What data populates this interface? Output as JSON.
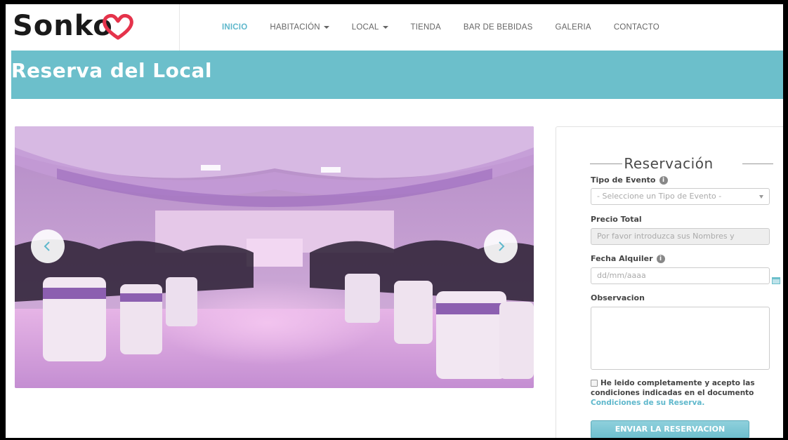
{
  "brand": {
    "logo_text": "Sonko"
  },
  "nav": {
    "items": [
      {
        "label": "INICIO",
        "active": true,
        "dropdown": false
      },
      {
        "label": "HABITACIÓN",
        "active": false,
        "dropdown": true
      },
      {
        "label": "LOCAL",
        "active": false,
        "dropdown": true
      },
      {
        "label": "TIENDA",
        "active": false,
        "dropdown": false
      },
      {
        "label": "BAR DE BEBIDAS",
        "active": false,
        "dropdown": false
      },
      {
        "label": "GALERIA",
        "active": false,
        "dropdown": false
      },
      {
        "label": "CONTACTO",
        "active": false,
        "dropdown": false
      }
    ]
  },
  "banner": {
    "title": "Reserva del Local"
  },
  "carousel": {
    "prev_icon": "chevron-left-icon",
    "next_icon": "chevron-right-icon"
  },
  "form": {
    "title": "Reservación",
    "event_type": {
      "label": "Tipo de Evento",
      "value": "- Seleccione un Tipo de Evento -"
    },
    "price": {
      "label": "Precio Total",
      "placeholder": "Por favor introduzca sus Nombres y"
    },
    "date": {
      "label": "Fecha Alquiler",
      "placeholder": "dd/mm/aaaa"
    },
    "notes": {
      "label": "Observacion",
      "value": ""
    },
    "terms": {
      "text": "He leido completamente y acepto las condiciones indicadas en el documento",
      "link": "Condiciones de su Reserva."
    },
    "submit_label": "ENVIAR LA RESERVACION"
  },
  "colors": {
    "accent": "#6cbfcb",
    "nav_active": "#5fb8cc",
    "logo_heart": "#e5334b"
  }
}
